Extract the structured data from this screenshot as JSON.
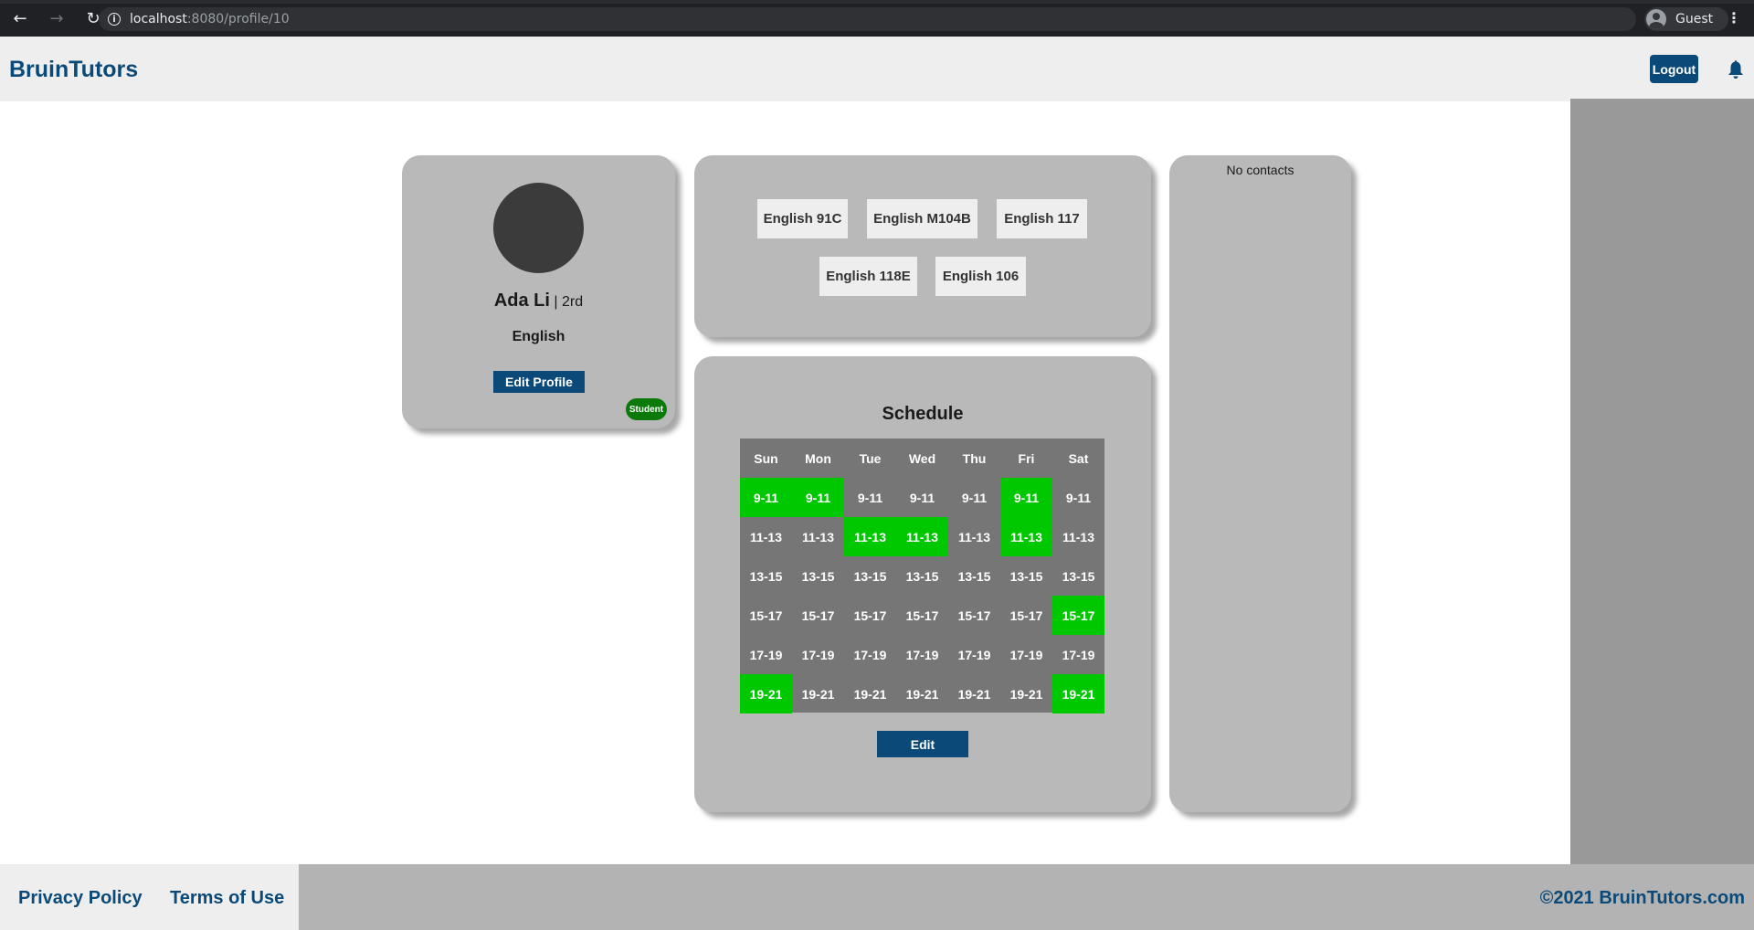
{
  "browser": {
    "url_host": "localhost",
    "url_path": ":8080/profile/10",
    "profile_label": "Guest"
  },
  "header": {
    "brand": "BruinTutors",
    "logout_label": "Logout"
  },
  "profile": {
    "name": "Ada Li",
    "year": "| 2rd",
    "major": "English",
    "edit_label": "Edit Profile",
    "role_badge": "Student"
  },
  "courses": [
    "English 91C",
    "English M104B",
    "English 117",
    "English 118E",
    "English 106"
  ],
  "schedule": {
    "title": "Schedule",
    "days": [
      "Sun",
      "Mon",
      "Tue",
      "Wed",
      "Thu",
      "Fri",
      "Sat"
    ],
    "slots": [
      "9-11",
      "11-13",
      "13-15",
      "15-17",
      "17-19",
      "19-21"
    ],
    "available": [
      [
        true,
        true,
        false,
        false,
        false,
        true,
        false
      ],
      [
        false,
        false,
        true,
        true,
        false,
        true,
        false
      ],
      [
        false,
        false,
        false,
        false,
        false,
        false,
        false
      ],
      [
        false,
        false,
        false,
        false,
        false,
        false,
        true
      ],
      [
        false,
        false,
        false,
        false,
        false,
        false,
        false
      ],
      [
        true,
        false,
        false,
        false,
        false,
        false,
        true
      ]
    ],
    "edit_label": "Edit"
  },
  "contacts": {
    "empty_text": "No contacts"
  },
  "footer": {
    "privacy": "Privacy Policy",
    "terms": "Terms of Use",
    "copyright": "©2021 BruinTutors.com"
  },
  "colors": {
    "brand": "#0b4a78",
    "available": "#00c800",
    "unavailable": "#767676",
    "badge": "#0b7a0b"
  }
}
